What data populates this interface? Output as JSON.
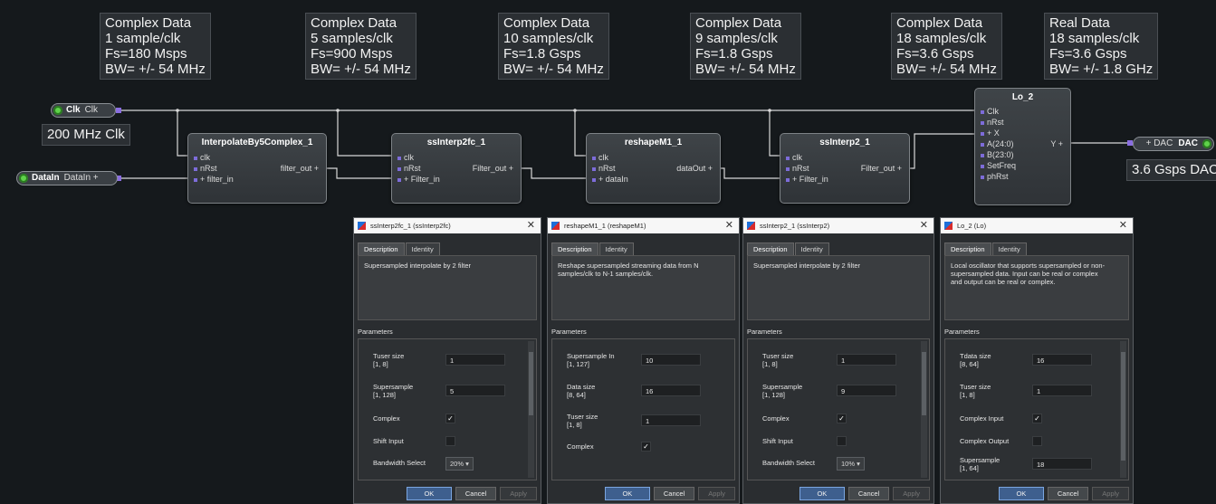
{
  "annotations": [
    {
      "lines": [
        "Complex Data",
        "1 sample/clk",
        "Fs=180 Msps",
        "BW= +/- 54 MHz"
      ]
    },
    {
      "lines": [
        "Complex Data",
        "5 samples/clk",
        "Fs=900 Msps",
        "BW= +/- 54 MHz"
      ]
    },
    {
      "lines": [
        "Complex Data",
        "10 samples/clk",
        "Fs=1.8 Gsps",
        "BW= +/- 54 MHz"
      ]
    },
    {
      "lines": [
        "Complex Data",
        "9 samples/clk",
        "Fs=1.8 Gsps",
        "BW= +/- 54 MHz"
      ]
    },
    {
      "lines": [
        "Complex Data",
        "18 samples/clk",
        "Fs=3.6 Gsps",
        "BW= +/- 54 MHz"
      ]
    },
    {
      "lines": [
        "Real Data",
        "18 samples/clk",
        "Fs=3.6 Gsps",
        "BW= +/- 1.8 GHz"
      ]
    }
  ],
  "notes": {
    "clk": "200 MHz Clk",
    "dac": "3.6 Gsps DAC"
  },
  "ports": {
    "clk": {
      "name": "Clk",
      "label": "Clk"
    },
    "datain": {
      "name": "DataIn",
      "label": "DataIn +"
    },
    "dac": {
      "name": "DAC",
      "label": "+ DAC"
    }
  },
  "blocks": [
    {
      "title": "InterpolateBy5Complex_1",
      "inputs": [
        "clk",
        "nRst",
        "+ filter_in"
      ],
      "outputs": [
        "filter_out +"
      ]
    },
    {
      "title": "ssInterp2fc_1",
      "inputs": [
        "clk",
        "nRst",
        "+ Filter_in"
      ],
      "outputs": [
        "Filter_out +"
      ]
    },
    {
      "title": "reshapeM1_1",
      "inputs": [
        "clk",
        "nRst",
        "+ dataIn"
      ],
      "outputs": [
        "dataOut +"
      ]
    },
    {
      "title": "ssInterp2_1",
      "inputs": [
        "clk",
        "nRst",
        "+ Filter_in"
      ],
      "outputs": [
        "Filter_out +"
      ]
    },
    {
      "title": "Lo_2",
      "inputs": [
        "Clk",
        "nRst",
        "+ X",
        "A(24:0)",
        "B(23:0)",
        "SetFreq",
        "phRst"
      ],
      "outputs": [
        "Y +"
      ]
    }
  ],
  "dialogs": [
    {
      "title": "ssInterp2fc_1 (ssInterp2fc)",
      "tabs": [
        "Description",
        "Identity"
      ],
      "description": "Supersampled interpolate by 2 filter",
      "params_header": "Parameters",
      "rows": [
        {
          "label": "Tuser size\n[1, 8]",
          "kind": "text",
          "value": "1"
        },
        {
          "label": "Supersample\n[1, 128]",
          "kind": "text",
          "value": "5"
        },
        {
          "label": "Complex",
          "kind": "check",
          "value": "✓"
        },
        {
          "label": "Shift Input",
          "kind": "check",
          "value": ""
        },
        {
          "label": "Bandwidth Select",
          "kind": "select",
          "value": "20%"
        }
      ],
      "buttons": {
        "ok": "OK",
        "cancel": "Cancel",
        "apply": "Apply"
      }
    },
    {
      "title": "reshapeM1_1 (reshapeM1)",
      "tabs": [
        "Description",
        "Identity"
      ],
      "description": "Reshape supersampled streaming data from N\nsamples/clk to N-1 samples/clk.",
      "params_header": "Parameters",
      "rows": [
        {
          "label": "Supersample In\n[1, 127]",
          "kind": "text",
          "value": "10"
        },
        {
          "label": "Data size\n[8, 64]",
          "kind": "text",
          "value": "16"
        },
        {
          "label": "Tuser size\n[1, 8]",
          "kind": "text",
          "value": "1"
        },
        {
          "label": "Complex",
          "kind": "check",
          "value": "✓"
        }
      ],
      "buttons": {
        "ok": "OK",
        "cancel": "Cancel",
        "apply": "Apply"
      }
    },
    {
      "title": "ssInterp2_1 (ssInterp2)",
      "tabs": [
        "Description",
        "Identity"
      ],
      "description": "Supersampled interpolate by 2 filter",
      "params_header": "Parameters",
      "rows": [
        {
          "label": "Tuser size\n[1, 8]",
          "kind": "text",
          "value": "1"
        },
        {
          "label": "Supersample\n[1, 128]",
          "kind": "text",
          "value": "9"
        },
        {
          "label": "Complex",
          "kind": "check",
          "value": "✓"
        },
        {
          "label": "Shift Input",
          "kind": "check",
          "value": ""
        },
        {
          "label": "Bandwidth Select",
          "kind": "select",
          "value": "10%"
        }
      ],
      "buttons": {
        "ok": "OK",
        "cancel": "Cancel",
        "apply": "Apply"
      }
    },
    {
      "title": "Lo_2 (Lo)",
      "tabs": [
        "Description",
        "Identity"
      ],
      "description": "Local oscillator that supports supersampled or non-\nsupersampled data.  Input can be real or complex\nand output can be real or complex.",
      "params_header": "Parameters",
      "rows": [
        {
          "label": "Tdata size\n[8, 64]",
          "kind": "text",
          "value": "16"
        },
        {
          "label": "Tuser size\n[1, 8]",
          "kind": "text",
          "value": "1"
        },
        {
          "label": "Complex Input",
          "kind": "check",
          "value": "✓"
        },
        {
          "label": "Complex Output",
          "kind": "check",
          "value": ""
        },
        {
          "label": "Supersample\n[1, 64]",
          "kind": "text",
          "value": "18"
        }
      ],
      "buttons": {
        "ok": "OK",
        "cancel": "Cancel",
        "apply": "Apply"
      }
    }
  ]
}
